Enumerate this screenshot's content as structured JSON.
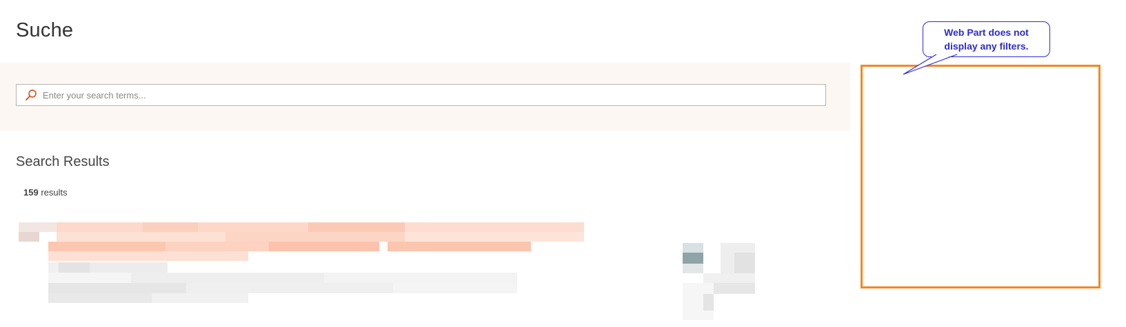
{
  "page": {
    "title": "Suche"
  },
  "search": {
    "placeholder": "Enter your search terms...",
    "value": ""
  },
  "results": {
    "heading": "Search Results",
    "count_number": "159",
    "count_label": "results"
  },
  "annotation": {
    "callout_line1": "Web Part does not",
    "callout_line2": "display any filters."
  },
  "colors": {
    "accent": "#d83b01",
    "band": "#fdf7f4",
    "panel_border": "#f5871f",
    "callout": "#2b2bd6"
  },
  "icons": {
    "search": "search-icon"
  }
}
